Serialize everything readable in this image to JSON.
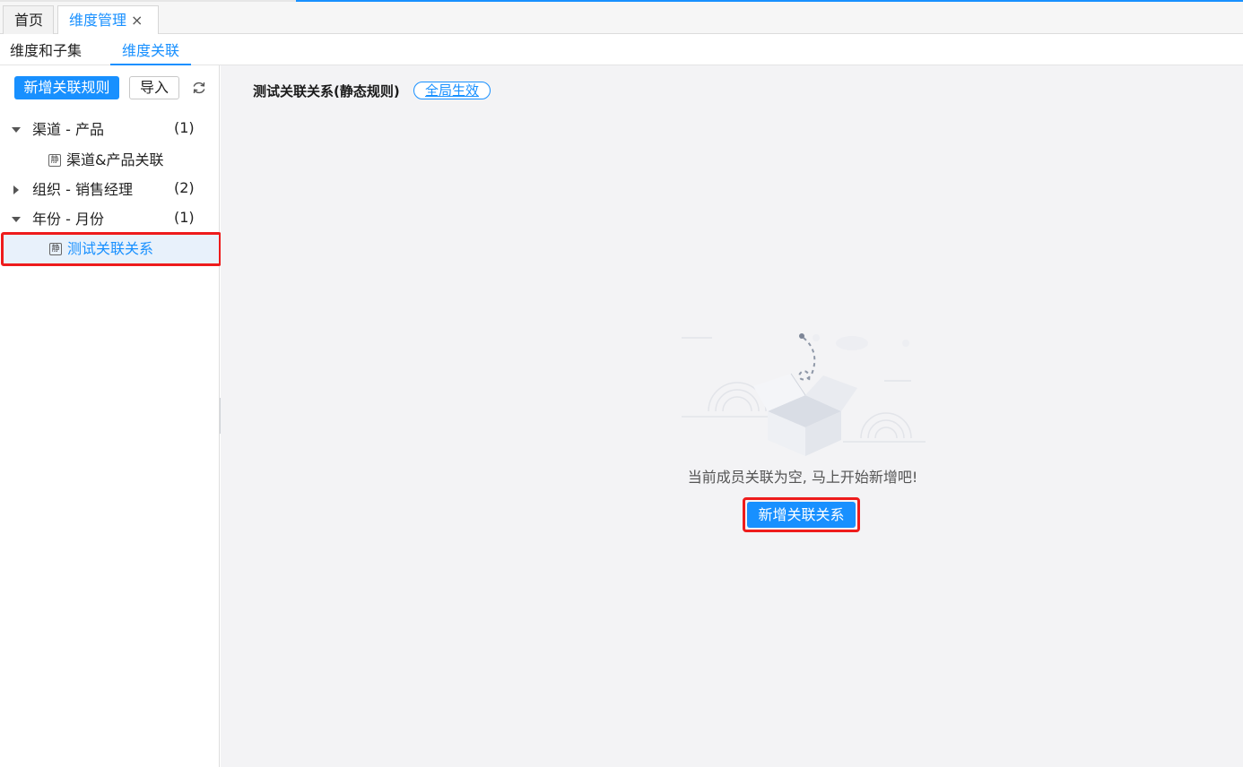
{
  "page_tabs": {
    "home_label": "首页",
    "active_label": "维度管理",
    "close_glyph": "×"
  },
  "sub_tabs": {
    "tab1_label": "维度和子集",
    "tab2_label": "维度关联"
  },
  "sidebar": {
    "add_rule_label": "新增关联规则",
    "import_label": "导入",
    "refresh_icon": "refresh-icon",
    "leaf_icon_glyph": "静",
    "groups": [
      {
        "label": "渠道 - 产品",
        "count": "(1)",
        "expanded": true,
        "children": [
          "渠道&产品关联"
        ]
      },
      {
        "label": "组织 - 销售经理",
        "count": "(2)",
        "expanded": false,
        "children": []
      },
      {
        "label": "年份 - 月份",
        "count": "(1)",
        "expanded": true,
        "children": [
          "测试关联关系"
        ]
      }
    ]
  },
  "main": {
    "title": "测试关联关系(静态规则)",
    "scope_tag": "全局生效",
    "empty_text": "当前成员关联为空, 马上开始新增吧!",
    "add_button_label": "新增关联关系"
  },
  "colors": {
    "accent": "#1890ff",
    "highlight": "#ee1c1c",
    "main_bg": "#f3f3f5"
  }
}
